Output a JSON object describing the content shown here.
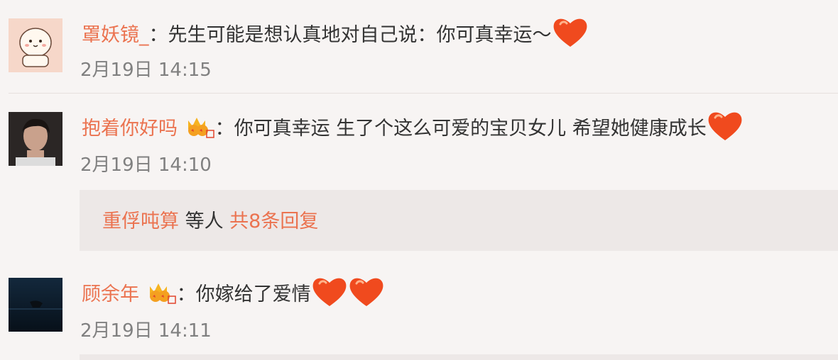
{
  "comments": [
    {
      "user": "罩妖镜_",
      "text": "：先生可能是想认真地对自己说：你可真幸运～",
      "time": "2月19日 14:15",
      "emoji_icons": [
        "heart-emoji-icon"
      ]
    },
    {
      "user": "抱着你好吗",
      "text": "：你可真幸运 生了个这么可爱的宝贝女儿 希望她健康成长",
      "time": "2月19日 14:10",
      "emoji_icons": [
        "heart-emoji-icon"
      ],
      "badge_icon": "crown-vip-icon"
    },
    {
      "user": "顾余年",
      "text": "：你嫁给了爱情",
      "time": "2月19日 14:11",
      "emoji_icons": [
        "heart-emoji-icon",
        "heart-emoji-icon"
      ],
      "badge_icon": "crown-vip-icon"
    }
  ],
  "reply_summary": {
    "user": "重俘吨算",
    "middle": " 等人 ",
    "count_text": "共8条回复"
  },
  "colors": {
    "username": "#eb7350",
    "text": "#333333",
    "time": "#808080",
    "background": "#f7f4f3",
    "reply_bg": "#ede8e7"
  }
}
